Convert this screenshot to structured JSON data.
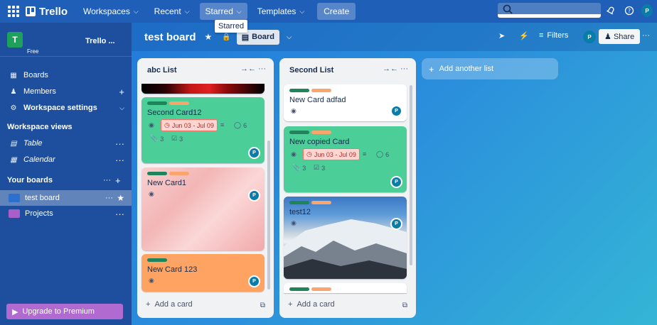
{
  "topbar": {
    "logo": "Trello",
    "nav": [
      {
        "label": "Workspaces"
      },
      {
        "label": "Recent"
      },
      {
        "label": "Starred"
      },
      {
        "label": "Templates"
      }
    ],
    "create_label": "Create",
    "tooltip": "Starred",
    "user_initial": "P"
  },
  "sidebar": {
    "workspace_initial": "T",
    "workspace_name": "Trello ...",
    "workspace_plan": "Free",
    "items": [
      {
        "label": "Boards",
        "icon": "board-icon"
      },
      {
        "label": "Members",
        "icon": "members-icon"
      },
      {
        "label": "Workspace settings",
        "icon": "gear-icon"
      }
    ],
    "views_heading": "Workspace views",
    "views": [
      {
        "label": "Table",
        "icon": "table-icon"
      },
      {
        "label": "Calendar",
        "icon": "calendar-icon"
      }
    ],
    "boards_heading": "Your boards",
    "boards": [
      {
        "label": "test board",
        "color": "#2c6fcf"
      },
      {
        "label": "Projects",
        "color": "#a860c8"
      }
    ],
    "upgrade_label": "Upgrade to Premium"
  },
  "boardbar": {
    "title": "test board",
    "view_label": "Board",
    "filters_label": "Filters",
    "share_label": "Share",
    "user_initial": "P"
  },
  "lists": [
    {
      "title": "abc List",
      "cards": [
        {
          "title": "Second Card12",
          "date": "Jun 03 - Jul 09",
          "comments": "6",
          "attachments": "3",
          "checklist": "3",
          "member": "P"
        },
        {
          "title": "New Card1",
          "member": "P"
        },
        {
          "title": "New Card 123",
          "member": "P"
        }
      ],
      "add_label": "Add a card"
    },
    {
      "title": "Second List",
      "cards": [
        {
          "title": "New Card adfad",
          "member": "P"
        },
        {
          "title": "New copied Card",
          "date": "Jun 03 - Jul 09",
          "comments": "6",
          "attachments": "3",
          "checklist": "3",
          "member": "P"
        },
        {
          "title": "test12",
          "member": "P"
        }
      ],
      "add_label": "Add a card"
    }
  ],
  "add_list_label": "Add another list",
  "colors": {
    "green_card": "#4bce97",
    "orange_card": "#fea362",
    "pink_card": "#f7c5c5",
    "label_green": "#1f845a",
    "label_orange": "#faa56b"
  }
}
